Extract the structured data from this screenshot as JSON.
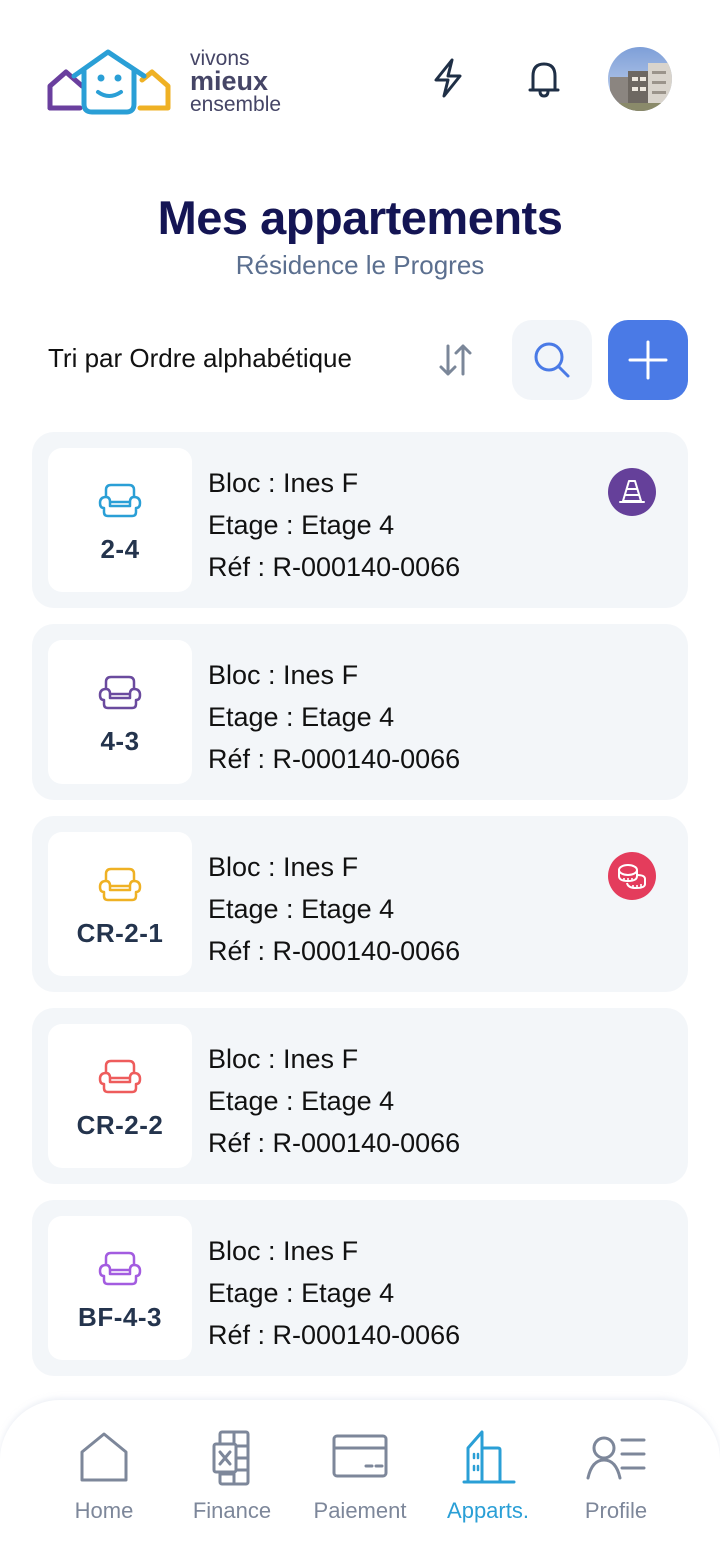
{
  "header": {
    "logo": {
      "line1": "vivons",
      "line2": "mieux",
      "line3": "ensemble"
    },
    "icons": [
      "lightning-icon",
      "bell-icon"
    ],
    "avatar_alt": "building-photo"
  },
  "page": {
    "title": "Mes appartements",
    "subtitle": "Résidence le Progres"
  },
  "toolbar": {
    "sort_label": "Tri par Ordre alphabétique",
    "sort_icon": "sort-arrows-icon",
    "search_icon": "search-icon",
    "add_icon": "plus-icon"
  },
  "apartments": [
    {
      "code": "2-4",
      "sofa_color": "#2a9fd6",
      "bloc": "Bloc : Ines F",
      "etage": "Etage : Etage 4",
      "ref": "Réf : R-000140-0066",
      "badge": "traffic-cone-icon",
      "badge_color": "#65409a"
    },
    {
      "code": "4-3",
      "sofa_color": "#6a4a9e",
      "bloc": "Bloc : Ines F",
      "etage": "Etage : Etage 4",
      "ref": "Réf : R-000140-0066",
      "badge": null
    },
    {
      "code": "CR-2-1",
      "sofa_color": "#efb124",
      "bloc": "Bloc : Ines F",
      "etage": "Etage : Etage 4",
      "ref": "Réf : R-000140-0066",
      "badge": "coins-icon",
      "badge_color": "#e43c5c"
    },
    {
      "code": "CR-2-2",
      "sofa_color": "#ee5c5c",
      "bloc": "Bloc : Ines F",
      "etage": "Etage : Etage 4",
      "ref": "Réf : R-000140-0066",
      "badge": null
    },
    {
      "code": "BF-4-3",
      "sofa_color": "#a35ce0",
      "bloc": "Bloc : Ines F",
      "etage": "Etage : Etage 4",
      "ref": "Réf : R-000140-0066",
      "badge": null
    }
  ],
  "bottom_nav": {
    "items": [
      {
        "label": "Home",
        "icon": "home-icon",
        "active": false
      },
      {
        "label": "Finance",
        "icon": "spreadsheet-icon",
        "active": false
      },
      {
        "label": "Paiement",
        "icon": "card-icon",
        "active": false
      },
      {
        "label": "Apparts.",
        "icon": "buildings-icon",
        "active": true
      },
      {
        "label": "Profile",
        "icon": "profile-list-icon",
        "active": false
      }
    ]
  },
  "colors": {
    "title": "#141554",
    "subtitle": "#5b6f8f",
    "accent": "#4a7ae6",
    "nav_active": "#2a9fd6",
    "nav_inactive": "#7d879a",
    "card_bg": "#f3f6f9"
  }
}
